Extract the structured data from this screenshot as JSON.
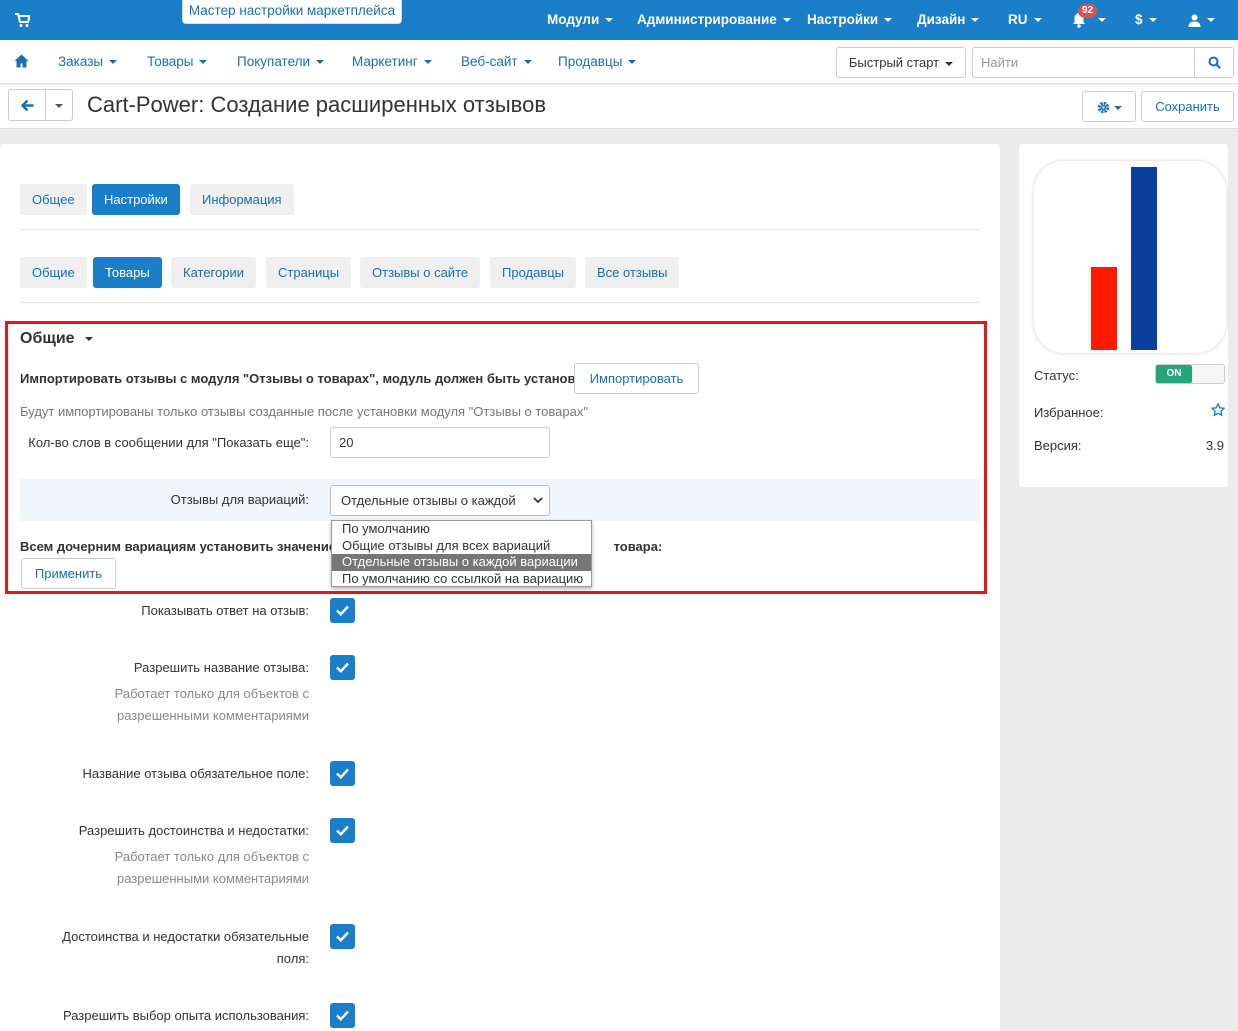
{
  "topbar": {
    "wizard": "Мастер настройки маркетплейса",
    "menu": [
      "Модули",
      "Администрирование",
      "Настройки",
      "Дизайн",
      "RU",
      "$"
    ],
    "notifications": "92"
  },
  "nav": {
    "items": [
      "Заказы",
      "Товары",
      "Покупатели",
      "Маркетинг",
      "Веб-сайт",
      "Продавцы"
    ],
    "quick_start": "Быстрый старт",
    "search_placeholder": "Найти"
  },
  "page": {
    "title": "Cart-Power: Создание расширенных отзывов",
    "save": "Сохранить"
  },
  "tabs": {
    "main": [
      "Общее",
      "Настройки",
      "Информация"
    ],
    "sub": [
      "Общие",
      "Товары",
      "Категории",
      "Страницы",
      "Отзывы о сайте",
      "Продавцы",
      "Все отзывы"
    ]
  },
  "section": {
    "title": "Общие",
    "import_label": "Импортировать отзывы с модуля \"Отзывы о товарах\", модуль должен быть установлен:",
    "import_button": "Импортировать",
    "import_note": "Будут импортированы только отзывы созданные после установки модуля \"Отзывы о товарах\"",
    "words_label": "Кол-во слов в сообщении для \"Показать еще\":",
    "words_value": "20",
    "variations_label": "Отзывы для вариаций:",
    "variations_selected": "Отдельные отзывы о каждой",
    "variations_options": [
      "По умолчанию",
      "Общие отзывы для всех вариаций",
      "Отдельные отзывы о каждой вариации",
      "По умолчанию со ссылкой на вариацию"
    ],
    "children_label_start": "Всем дочерним вариациям установить значение н",
    "children_label_end": "товара:",
    "apply_button": "Применить"
  },
  "settings": {
    "show_answer": "Показывать ответ на отзыв:",
    "allow_title": "Разрешить название отзыва:",
    "works_only_1": "Работает только для объектов с",
    "works_only_2": "разрешенными комментариями",
    "title_required": "Название отзыва обязательное поле:",
    "allow_pros_cons": "Разрешить достоинства и недостатки:",
    "pros_cons_required_1": "Достоинства и недостатки обязательные",
    "pros_cons_required_2": "поля:",
    "allow_experience": "Разрешить выбор опыта использования:"
  },
  "sidebar": {
    "status_label": "Статус:",
    "status_value": "ON",
    "favorite_label": "Избранное:",
    "version_label": "Версия:",
    "version_value": "3.9"
  },
  "colors": {
    "primary": "#1a7ec8",
    "status_on": "#27a57a",
    "highlight": "#e5151b",
    "logo_red": "#ff1a00",
    "logo_blue": "#0a3f9e"
  },
  "icons": [
    "cart-icon",
    "bell-icon",
    "user-icon",
    "home-icon",
    "search-icon",
    "arrow-left-icon",
    "gear-icon",
    "check-icon",
    "star-icon"
  ]
}
